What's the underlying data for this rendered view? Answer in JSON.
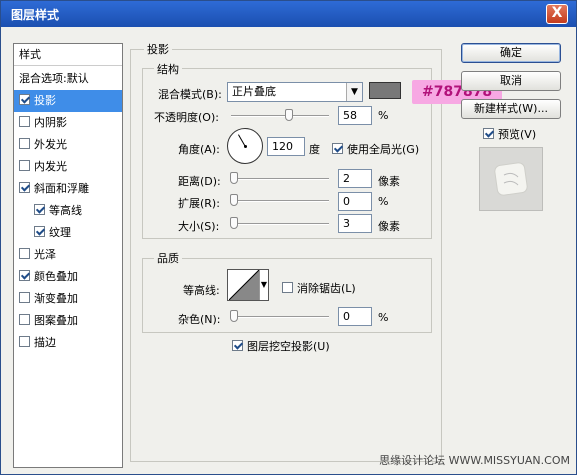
{
  "window": {
    "title": "图层样式",
    "close": "X"
  },
  "left_panel": {
    "header": "样式",
    "items": [
      {
        "label": "混合选项:默认",
        "checkbox": null,
        "selected": false
      },
      {
        "label": "投影",
        "checkbox": true,
        "selected": true
      },
      {
        "label": "内阴影",
        "checkbox": false,
        "selected": false
      },
      {
        "label": "外发光",
        "checkbox": false,
        "selected": false
      },
      {
        "label": "内发光",
        "checkbox": false,
        "selected": false
      },
      {
        "label": "斜面和浮雕",
        "checkbox": true,
        "selected": false
      },
      {
        "label": "等高线",
        "checkbox": true,
        "selected": false,
        "indent": true
      },
      {
        "label": "纹理",
        "checkbox": true,
        "selected": false,
        "indent": true
      },
      {
        "label": "光泽",
        "checkbox": false,
        "selected": false
      },
      {
        "label": "颜色叠加",
        "checkbox": true,
        "selected": false
      },
      {
        "label": "渐变叠加",
        "checkbox": false,
        "selected": false
      },
      {
        "label": "图案叠加",
        "checkbox": false,
        "selected": false
      },
      {
        "label": "描边",
        "checkbox": false,
        "selected": false
      }
    ]
  },
  "drop_shadow": {
    "section_title": "投影",
    "structure_title": "结构",
    "blend_mode_label": "混合模式(B):",
    "blend_mode_value": "正片叠底",
    "shadow_color": "#787878",
    "opacity_label": "不透明度(O):",
    "opacity_value": "58",
    "opacity_unit": "%",
    "angle_label": "角度(A):",
    "angle_value": "120",
    "angle_unit": "度",
    "global_light_label": "使用全局光(G)",
    "global_light": true,
    "distance_label": "距离(D):",
    "distance_value": "2",
    "distance_unit": "像素",
    "spread_label": "扩展(R):",
    "spread_value": "0",
    "spread_unit": "%",
    "size_label": "大小(S):",
    "size_value": "3",
    "size_unit": "像素",
    "quality_title": "品质",
    "contour_label": "等高线:",
    "anti_alias_label": "消除锯齿(L)",
    "anti_alias": false,
    "noise_label": "杂色(N):",
    "noise_value": "0",
    "noise_unit": "%",
    "knockout_label": "图层挖空投影(U)",
    "knockout": true
  },
  "buttons": {
    "ok": "确定",
    "cancel": "取消",
    "new_style": "新建样式(W)...",
    "preview": "预览(V)"
  },
  "annotation": "#787878",
  "watermark": "思缘设计论坛 WWW.MISSYUAN.COM"
}
